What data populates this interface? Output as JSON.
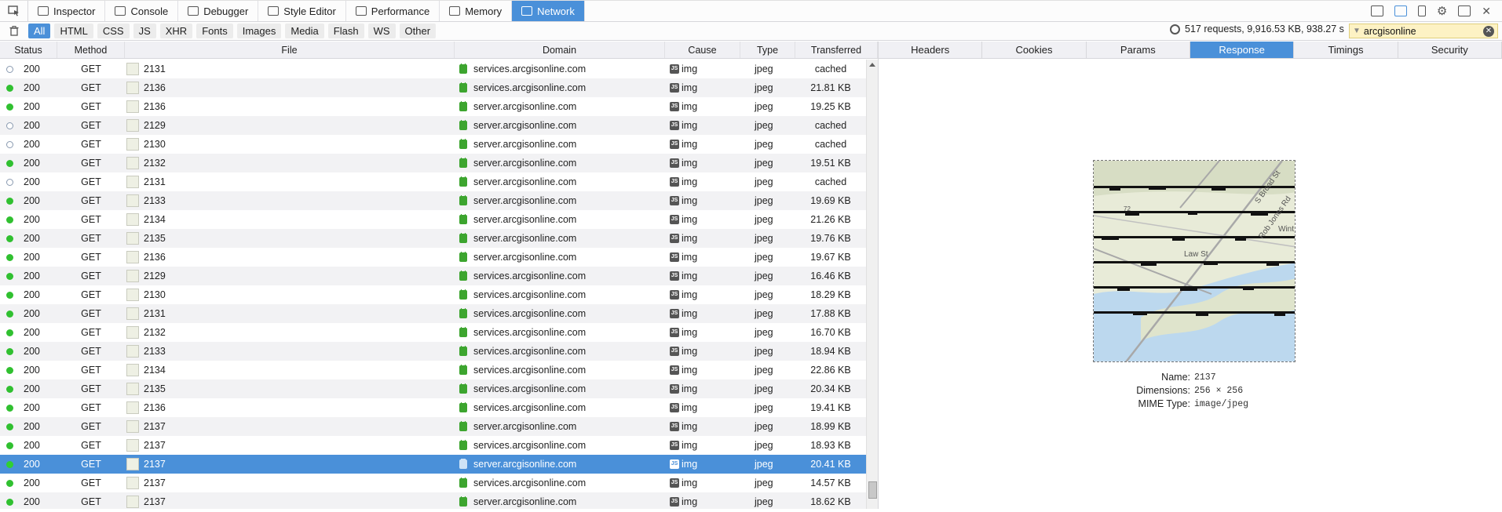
{
  "toolbar": {
    "tabs": [
      {
        "label": "Inspector",
        "icon": "inspector-icon"
      },
      {
        "label": "Console",
        "icon": "console-icon"
      },
      {
        "label": "Debugger",
        "icon": "debugger-icon"
      },
      {
        "label": "Style Editor",
        "icon": "style-editor-icon"
      },
      {
        "label": "Performance",
        "icon": "performance-icon"
      },
      {
        "label": "Memory",
        "icon": "memory-icon"
      },
      {
        "label": "Network",
        "icon": "network-icon",
        "active": true
      }
    ]
  },
  "filters": {
    "buttons": [
      "All",
      "HTML",
      "CSS",
      "JS",
      "XHR",
      "Fonts",
      "Images",
      "Media",
      "Flash",
      "WS",
      "Other"
    ],
    "active": "All",
    "summary": "517 requests, 9,916.53 KB, 938.27 s",
    "search_value": "arcgisonline"
  },
  "columns": {
    "status": "Status",
    "method": "Method",
    "file": "File",
    "domain": "Domain",
    "cause": "Cause",
    "type": "Type",
    "transferred": "Transferred"
  },
  "requests": [
    {
      "status": "200",
      "method": "GET",
      "file": "2131",
      "domain": "services.arcgisonline.com",
      "cause": "img",
      "type": "jpeg",
      "transferred": "cached",
      "cached": true
    },
    {
      "status": "200",
      "method": "GET",
      "file": "2136",
      "domain": "services.arcgisonline.com",
      "cause": "img",
      "type": "jpeg",
      "transferred": "21.81 KB"
    },
    {
      "status": "200",
      "method": "GET",
      "file": "2136",
      "domain": "server.arcgisonline.com",
      "cause": "img",
      "type": "jpeg",
      "transferred": "19.25 KB"
    },
    {
      "status": "200",
      "method": "GET",
      "file": "2129",
      "domain": "server.arcgisonline.com",
      "cause": "img",
      "type": "jpeg",
      "transferred": "cached",
      "cached": true
    },
    {
      "status": "200",
      "method": "GET",
      "file": "2130",
      "domain": "server.arcgisonline.com",
      "cause": "img",
      "type": "jpeg",
      "transferred": "cached",
      "cached": true
    },
    {
      "status": "200",
      "method": "GET",
      "file": "2132",
      "domain": "server.arcgisonline.com",
      "cause": "img",
      "type": "jpeg",
      "transferred": "19.51 KB"
    },
    {
      "status": "200",
      "method": "GET",
      "file": "2131",
      "domain": "server.arcgisonline.com",
      "cause": "img",
      "type": "jpeg",
      "transferred": "cached",
      "cached": true
    },
    {
      "status": "200",
      "method": "GET",
      "file": "2133",
      "domain": "server.arcgisonline.com",
      "cause": "img",
      "type": "jpeg",
      "transferred": "19.69 KB"
    },
    {
      "status": "200",
      "method": "GET",
      "file": "2134",
      "domain": "server.arcgisonline.com",
      "cause": "img",
      "type": "jpeg",
      "transferred": "21.26 KB"
    },
    {
      "status": "200",
      "method": "GET",
      "file": "2135",
      "domain": "server.arcgisonline.com",
      "cause": "img",
      "type": "jpeg",
      "transferred": "19.76 KB"
    },
    {
      "status": "200",
      "method": "GET",
      "file": "2136",
      "domain": "server.arcgisonline.com",
      "cause": "img",
      "type": "jpeg",
      "transferred": "19.67 KB"
    },
    {
      "status": "200",
      "method": "GET",
      "file": "2129",
      "domain": "services.arcgisonline.com",
      "cause": "img",
      "type": "jpeg",
      "transferred": "16.46 KB"
    },
    {
      "status": "200",
      "method": "GET",
      "file": "2130",
      "domain": "services.arcgisonline.com",
      "cause": "img",
      "type": "jpeg",
      "transferred": "18.29 KB"
    },
    {
      "status": "200",
      "method": "GET",
      "file": "2131",
      "domain": "services.arcgisonline.com",
      "cause": "img",
      "type": "jpeg",
      "transferred": "17.88 KB"
    },
    {
      "status": "200",
      "method": "GET",
      "file": "2132",
      "domain": "services.arcgisonline.com",
      "cause": "img",
      "type": "jpeg",
      "transferred": "16.70 KB"
    },
    {
      "status": "200",
      "method": "GET",
      "file": "2133",
      "domain": "services.arcgisonline.com",
      "cause": "img",
      "type": "jpeg",
      "transferred": "18.94 KB"
    },
    {
      "status": "200",
      "method": "GET",
      "file": "2134",
      "domain": "services.arcgisonline.com",
      "cause": "img",
      "type": "jpeg",
      "transferred": "22.86 KB"
    },
    {
      "status": "200",
      "method": "GET",
      "file": "2135",
      "domain": "services.arcgisonline.com",
      "cause": "img",
      "type": "jpeg",
      "transferred": "20.34 KB"
    },
    {
      "status": "200",
      "method": "GET",
      "file": "2136",
      "domain": "services.arcgisonline.com",
      "cause": "img",
      "type": "jpeg",
      "transferred": "19.41 KB"
    },
    {
      "status": "200",
      "method": "GET",
      "file": "2137",
      "domain": "server.arcgisonline.com",
      "cause": "img",
      "type": "jpeg",
      "transferred": "18.99 KB"
    },
    {
      "status": "200",
      "method": "GET",
      "file": "2137",
      "domain": "services.arcgisonline.com",
      "cause": "img",
      "type": "jpeg",
      "transferred": "18.93 KB"
    },
    {
      "status": "200",
      "method": "GET",
      "file": "2137",
      "domain": "server.arcgisonline.com",
      "cause": "img",
      "type": "jpeg",
      "transferred": "20.41 KB",
      "selected": true
    },
    {
      "status": "200",
      "method": "GET",
      "file": "2137",
      "domain": "services.arcgisonline.com",
      "cause": "img",
      "type": "jpeg",
      "transferred": "14.57 KB"
    },
    {
      "status": "200",
      "method": "GET",
      "file": "2137",
      "domain": "server.arcgisonline.com",
      "cause": "img",
      "type": "jpeg",
      "transferred": "18.62 KB"
    }
  ],
  "details": {
    "tabs": [
      "Headers",
      "Cookies",
      "Params",
      "Response",
      "Timings",
      "Security"
    ],
    "active_tab": "Response",
    "preview_map_labels": [
      "S Broad St",
      "Rob Jones Rd",
      "Wint",
      "Law St",
      "72"
    ],
    "image": {
      "name_label": "Name:",
      "name": "2137",
      "dimensions_label": "Dimensions:",
      "dimensions": "256 × 256",
      "mime_label": "MIME Type:",
      "mime": "image/jpeg"
    }
  },
  "colors": {
    "accent": "#4a90d9",
    "success_dot": "#30c030",
    "lock": "#3da52f",
    "search_bg": "#fdf2c4"
  }
}
